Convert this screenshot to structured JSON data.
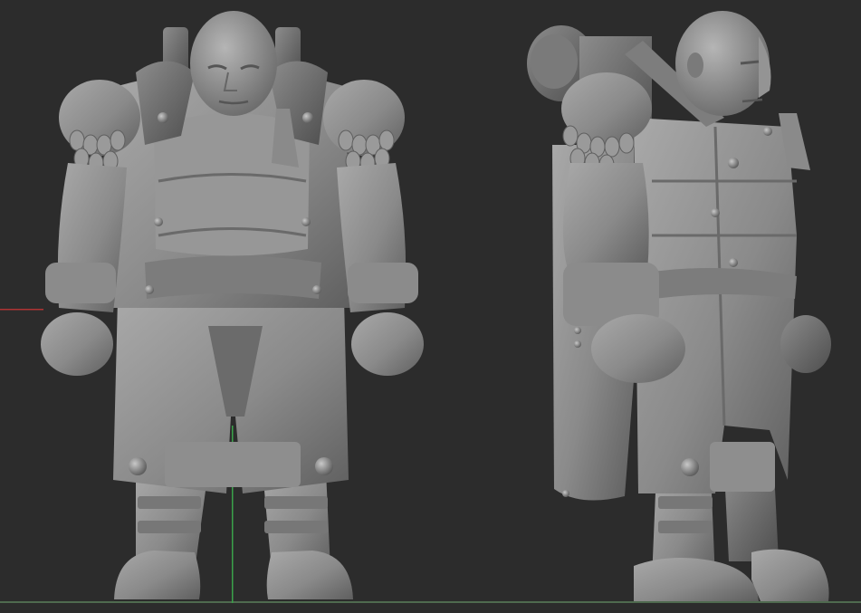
{
  "viewport": {
    "background": "#2c2c2c",
    "views": [
      {
        "name": "front-view"
      },
      {
        "name": "side-view"
      }
    ],
    "axes": {
      "x_axis_color": "#b03434",
      "y_axis_color": "#3aa24a",
      "ground_color": "#5b7a5b"
    },
    "model_color": "#8a8a8a"
  }
}
